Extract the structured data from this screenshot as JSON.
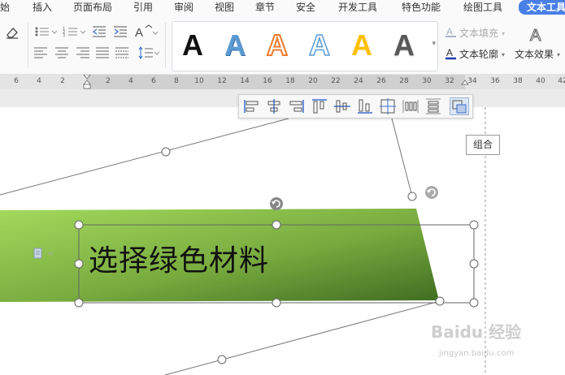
{
  "menu": {
    "items": [
      "始",
      "插入",
      "页面布局",
      "引用",
      "审阅",
      "视图",
      "章节",
      "安全",
      "开发工具",
      "特色功能",
      "绘图工具",
      "文本工具"
    ],
    "active": "文本工具"
  },
  "toolbar": {
    "text_fill_label": "文本填充",
    "text_outline_label": "文本轮廓",
    "text_effect_label": "文本效果",
    "style_letter": "A",
    "style_colors": [
      "#111111",
      "#5b9bd5",
      "#ed7d31",
      "#ffffff",
      "#ffc000",
      "#595959"
    ]
  },
  "ruler": {
    "ticks": [
      "6",
      "4",
      "2",
      "2",
      "4",
      "6",
      "8",
      "10",
      "12",
      "14",
      "16",
      "18",
      "20",
      "22",
      "24",
      "26",
      "28",
      "30",
      "32",
      "34",
      "36",
      "38",
      "40",
      "42"
    ]
  },
  "align_toolbar": {
    "tooltip": "组合",
    "icons": [
      "align-left-icon",
      "align-center-icon",
      "align-right-icon",
      "align-top-icon",
      "align-middle-icon",
      "align-bottom-icon",
      "center-on-page-icon",
      "distribute-horizontal-icon",
      "distribute-vertical-icon",
      "group-icon"
    ]
  },
  "shape": {
    "text": "选择绿色材料",
    "gradient_start": "#9ed25a",
    "gradient_end": "#4a7d2a"
  },
  "watermark": {
    "brand": "Baidu 经验",
    "url": "jingyan.baidu.com"
  }
}
